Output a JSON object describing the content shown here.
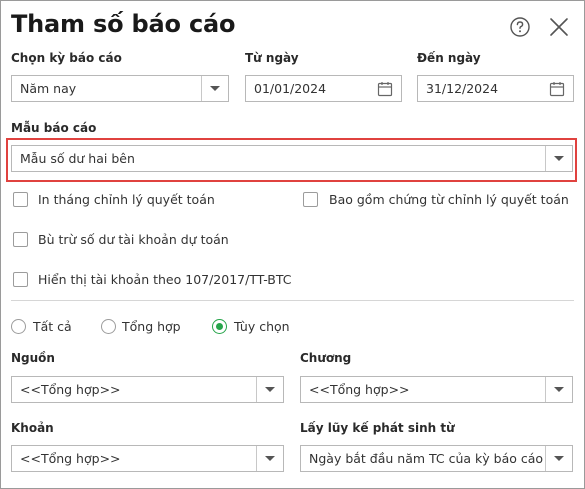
{
  "dialog": {
    "title": "Tham số báo cáo",
    "help_icon": "question-circle-icon",
    "close_icon": "close-x-icon"
  },
  "period": {
    "label": "Chọn kỳ báo cáo",
    "value": "Năm nay"
  },
  "from_date": {
    "label": "Từ ngày",
    "value": "01/01/2024",
    "icon": "calendar-icon"
  },
  "to_date": {
    "label": "Đến ngày",
    "value": "31/12/2024",
    "icon": "calendar-icon"
  },
  "template": {
    "label": "Mẫu báo cáo",
    "value": "Mẫu số dư hai bên",
    "highlight_color": "#e0423f"
  },
  "options": {
    "adjust_month": "In tháng chỉnh lý quyết toán",
    "include_adjust_docs": "Bao gồm chứng từ chỉnh lý quyết toán",
    "offset_budget_balance": "Bù trừ số dư tài khoản dự toán",
    "show_account_107": "Hiển thị tài khoản theo 107/2017/TT-BTC"
  },
  "mode": {
    "all": "Tất cả",
    "summary": "Tổng hợp",
    "custom": "Tùy chọn",
    "selected": "custom",
    "accent_color": "#26a44a"
  },
  "source": {
    "label": "Nguồn",
    "value": "<<Tổng hợp>>"
  },
  "chapter": {
    "label": "Chương",
    "value": "<<Tổng hợp>>"
  },
  "item": {
    "label": "Khoản",
    "value": "<<Tổng hợp>>"
  },
  "accumulate_from": {
    "label": "Lấy lũy kế phát sinh từ",
    "value": "Ngày bắt đầu năm TC của kỳ báo cáo"
  }
}
